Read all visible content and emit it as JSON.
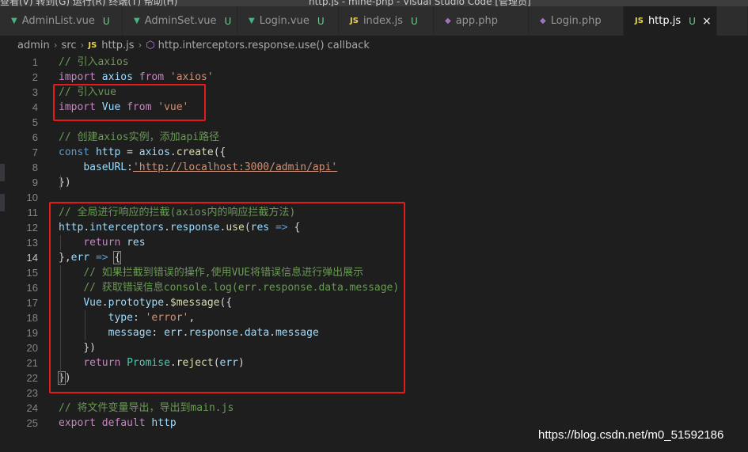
{
  "titlebar": {
    "menu_text": "查看(V)  转到(G)  运行(R)  终端(T)  帮助(H)",
    "window_title": "http.js - mine-php - Visual Studio Code [管理员]"
  },
  "tabs": [
    {
      "name": "AdminList.vue",
      "type": "vue",
      "modified": "U",
      "active": false
    },
    {
      "name": "AdminSet.vue",
      "type": "vue",
      "modified": "U",
      "active": false
    },
    {
      "name": "Login.vue",
      "type": "vue",
      "modified": "U",
      "active": false
    },
    {
      "name": "index.js",
      "type": "js",
      "modified": "U",
      "active": false
    },
    {
      "name": "app.php",
      "type": "php",
      "modified": "",
      "active": false
    },
    {
      "name": "Login.php",
      "type": "php",
      "modified": "",
      "active": false
    },
    {
      "name": "http.js",
      "type": "js",
      "modified": "U",
      "active": true
    }
  ],
  "icons": {
    "vue": "vue-logo-icon",
    "js": "JS",
    "php": "php-elephant-icon",
    "close": "×",
    "chevron": "›",
    "symbol": "cube-icon"
  },
  "breadcrumb": {
    "p1": "admin",
    "p2": "src",
    "p3": "http.js",
    "p4": "http.interceptors.response.use() callback",
    "js_badge": "JS"
  },
  "current_line": 14,
  "line_numbers": [
    "1",
    "2",
    "3",
    "4",
    "5",
    "6",
    "7",
    "8",
    "9",
    "10",
    "11",
    "12",
    "13",
    "14",
    "15",
    "16",
    "17",
    "18",
    "19",
    "20",
    "21",
    "22",
    "23",
    "24",
    "25"
  ],
  "code": {
    "l1": "// 引入axios",
    "l2_kw": "import",
    "l2_id": "axios",
    "l2_from": "from",
    "l2_str": "'axios'",
    "l3": "// 引入vue",
    "l4_kw": "import",
    "l4_id": "Vue",
    "l4_from": "from",
    "l4_str": "'vue'",
    "l6": "// 创建axios实例，添加api路径",
    "l7_const": "const",
    "l7_var": "http",
    "l7_eq": " = ",
    "l7_obj": "axios",
    "l7_dot": ".",
    "l7_fn": "create",
    "l7_p": "({",
    "l8_key": "baseURL",
    "l8_colon": ":",
    "l8_str": "'http://localhost:3000/admin/api'",
    "l9": "})",
    "l11": "// 全局进行响应的拦截(axios内的响应拦截方法)",
    "l12_a": "http",
    "l12_b": "interceptors",
    "l12_c": "response",
    "l12_fn": "use",
    "l12_arg": "res",
    "l12_arrow": "=>",
    "l13_kw": "return",
    "l13_v": "res",
    "l14_a": "},",
    "l14_err": "err",
    "l14_arrow": "=>",
    "l14_br": "{",
    "l15": "// 如果拦截到错误的操作,使用VUE将错误信息进行弹出展示",
    "l16": "// 获取错误信息console.log(err.response.data.message)",
    "l17_a": "Vue",
    "l17_b": "prototype",
    "l17_c": "$message",
    "l17_p": "({",
    "l18_key": "type",
    "l18_str": "'error'",
    "l19_key": "message",
    "l19_a": "err",
    "l19_b": "response",
    "l19_c": "data",
    "l19_d": "message",
    "l20": "})",
    "l21_kw": "return",
    "l21_cls": "Promise",
    "l21_fn": "reject",
    "l21_arg": "err",
    "l22_br": "}",
    "l22_p": ")",
    "l24": "// 将文件变量导出，导出到main.js",
    "l25_kw": "export",
    "l25_def": "default",
    "l25_v": "http"
  },
  "watermark": "https://blog.csdn.net/m0_51592186",
  "colors": {
    "annotation_box": "#e51a1a",
    "comment": "#6a9955",
    "keyword": "#c586c0",
    "string": "#ce9178"
  }
}
